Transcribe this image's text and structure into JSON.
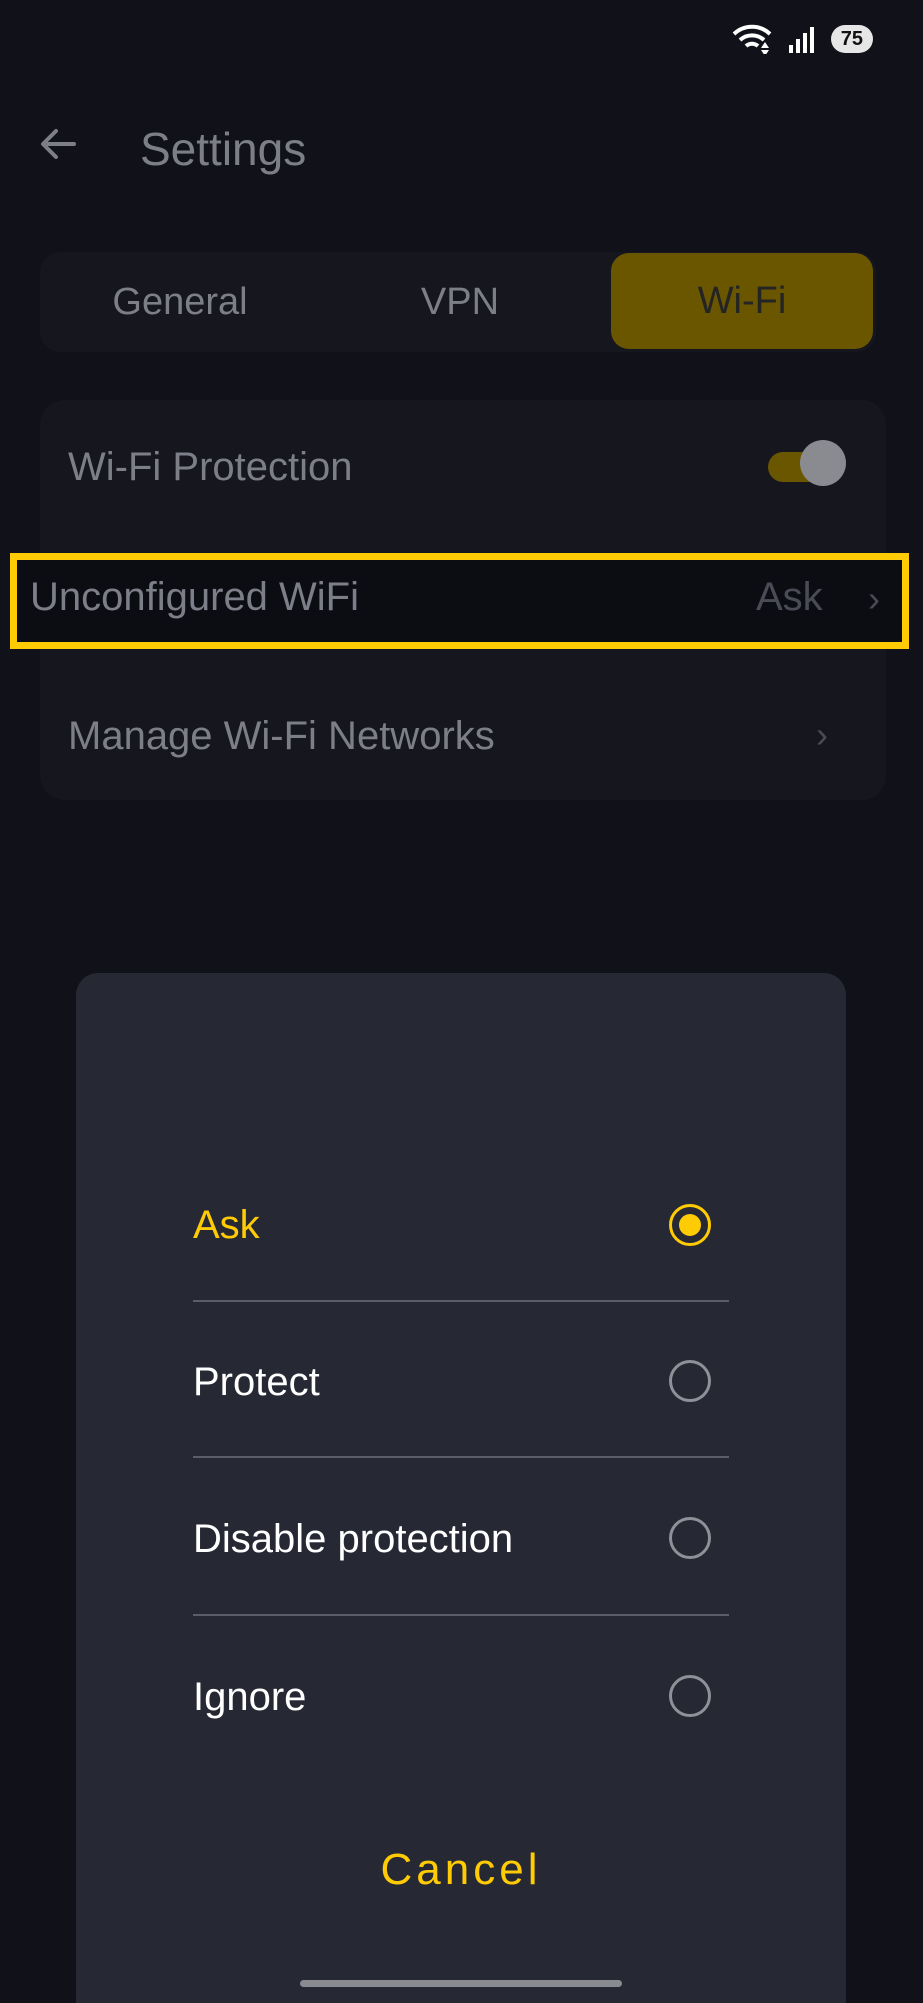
{
  "status_bar": {
    "battery": "75",
    "icons": [
      "wifi-icon",
      "signal-icon"
    ]
  },
  "header": {
    "title": "Settings",
    "back_icon": "arrow-left-icon"
  },
  "tabs": [
    {
      "label": "General",
      "active": false
    },
    {
      "label": "VPN",
      "active": false
    },
    {
      "label": "Wi-Fi",
      "active": true
    }
  ],
  "settings": {
    "wifi_protection": {
      "label": "Wi-Fi Protection",
      "enabled": true
    },
    "unconfigured_wifi": {
      "label": "Unconfigured WiFi",
      "value": "Ask"
    },
    "manage_networks": {
      "label": "Manage Wi-Fi Networks"
    }
  },
  "dialog": {
    "options": [
      {
        "label": "Ask",
        "selected": true
      },
      {
        "label": "Protect",
        "selected": false
      },
      {
        "label": "Disable protection",
        "selected": false
      },
      {
        "label": "Ignore",
        "selected": false
      }
    ],
    "cancel_label": "Cancel"
  },
  "colors": {
    "accent": "#ffcb05",
    "background": "#101119",
    "sheet": "#262834"
  }
}
